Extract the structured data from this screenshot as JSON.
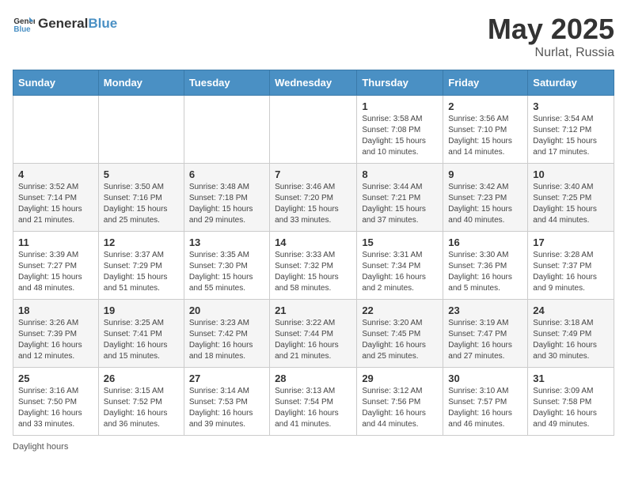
{
  "header": {
    "logo_general": "General",
    "logo_blue": "Blue",
    "month_year": "May 2025",
    "location": "Nurlat, Russia"
  },
  "days_of_week": [
    "Sunday",
    "Monday",
    "Tuesday",
    "Wednesday",
    "Thursday",
    "Friday",
    "Saturday"
  ],
  "weeks": [
    [
      {
        "day": "",
        "info": ""
      },
      {
        "day": "",
        "info": ""
      },
      {
        "day": "",
        "info": ""
      },
      {
        "day": "",
        "info": ""
      },
      {
        "day": "1",
        "info": "Sunrise: 3:58 AM\nSunset: 7:08 PM\nDaylight: 15 hours\nand 10 minutes."
      },
      {
        "day": "2",
        "info": "Sunrise: 3:56 AM\nSunset: 7:10 PM\nDaylight: 15 hours\nand 14 minutes."
      },
      {
        "day": "3",
        "info": "Sunrise: 3:54 AM\nSunset: 7:12 PM\nDaylight: 15 hours\nand 17 minutes."
      }
    ],
    [
      {
        "day": "4",
        "info": "Sunrise: 3:52 AM\nSunset: 7:14 PM\nDaylight: 15 hours\nand 21 minutes."
      },
      {
        "day": "5",
        "info": "Sunrise: 3:50 AM\nSunset: 7:16 PM\nDaylight: 15 hours\nand 25 minutes."
      },
      {
        "day": "6",
        "info": "Sunrise: 3:48 AM\nSunset: 7:18 PM\nDaylight: 15 hours\nand 29 minutes."
      },
      {
        "day": "7",
        "info": "Sunrise: 3:46 AM\nSunset: 7:20 PM\nDaylight: 15 hours\nand 33 minutes."
      },
      {
        "day": "8",
        "info": "Sunrise: 3:44 AM\nSunset: 7:21 PM\nDaylight: 15 hours\nand 37 minutes."
      },
      {
        "day": "9",
        "info": "Sunrise: 3:42 AM\nSunset: 7:23 PM\nDaylight: 15 hours\nand 40 minutes."
      },
      {
        "day": "10",
        "info": "Sunrise: 3:40 AM\nSunset: 7:25 PM\nDaylight: 15 hours\nand 44 minutes."
      }
    ],
    [
      {
        "day": "11",
        "info": "Sunrise: 3:39 AM\nSunset: 7:27 PM\nDaylight: 15 hours\nand 48 minutes."
      },
      {
        "day": "12",
        "info": "Sunrise: 3:37 AM\nSunset: 7:29 PM\nDaylight: 15 hours\nand 51 minutes."
      },
      {
        "day": "13",
        "info": "Sunrise: 3:35 AM\nSunset: 7:30 PM\nDaylight: 15 hours\nand 55 minutes."
      },
      {
        "day": "14",
        "info": "Sunrise: 3:33 AM\nSunset: 7:32 PM\nDaylight: 15 hours\nand 58 minutes."
      },
      {
        "day": "15",
        "info": "Sunrise: 3:31 AM\nSunset: 7:34 PM\nDaylight: 16 hours\nand 2 minutes."
      },
      {
        "day": "16",
        "info": "Sunrise: 3:30 AM\nSunset: 7:36 PM\nDaylight: 16 hours\nand 5 minutes."
      },
      {
        "day": "17",
        "info": "Sunrise: 3:28 AM\nSunset: 7:37 PM\nDaylight: 16 hours\nand 9 minutes."
      }
    ],
    [
      {
        "day": "18",
        "info": "Sunrise: 3:26 AM\nSunset: 7:39 PM\nDaylight: 16 hours\nand 12 minutes."
      },
      {
        "day": "19",
        "info": "Sunrise: 3:25 AM\nSunset: 7:41 PM\nDaylight: 16 hours\nand 15 minutes."
      },
      {
        "day": "20",
        "info": "Sunrise: 3:23 AM\nSunset: 7:42 PM\nDaylight: 16 hours\nand 18 minutes."
      },
      {
        "day": "21",
        "info": "Sunrise: 3:22 AM\nSunset: 7:44 PM\nDaylight: 16 hours\nand 21 minutes."
      },
      {
        "day": "22",
        "info": "Sunrise: 3:20 AM\nSunset: 7:45 PM\nDaylight: 16 hours\nand 25 minutes."
      },
      {
        "day": "23",
        "info": "Sunrise: 3:19 AM\nSunset: 7:47 PM\nDaylight: 16 hours\nand 27 minutes."
      },
      {
        "day": "24",
        "info": "Sunrise: 3:18 AM\nSunset: 7:49 PM\nDaylight: 16 hours\nand 30 minutes."
      }
    ],
    [
      {
        "day": "25",
        "info": "Sunrise: 3:16 AM\nSunset: 7:50 PM\nDaylight: 16 hours\nand 33 minutes."
      },
      {
        "day": "26",
        "info": "Sunrise: 3:15 AM\nSunset: 7:52 PM\nDaylight: 16 hours\nand 36 minutes."
      },
      {
        "day": "27",
        "info": "Sunrise: 3:14 AM\nSunset: 7:53 PM\nDaylight: 16 hours\nand 39 minutes."
      },
      {
        "day": "28",
        "info": "Sunrise: 3:13 AM\nSunset: 7:54 PM\nDaylight: 16 hours\nand 41 minutes."
      },
      {
        "day": "29",
        "info": "Sunrise: 3:12 AM\nSunset: 7:56 PM\nDaylight: 16 hours\nand 44 minutes."
      },
      {
        "day": "30",
        "info": "Sunrise: 3:10 AM\nSunset: 7:57 PM\nDaylight: 16 hours\nand 46 minutes."
      },
      {
        "day": "31",
        "info": "Sunrise: 3:09 AM\nSunset: 7:58 PM\nDaylight: 16 hours\nand 49 minutes."
      }
    ]
  ],
  "footer": {
    "note": "Daylight hours"
  }
}
